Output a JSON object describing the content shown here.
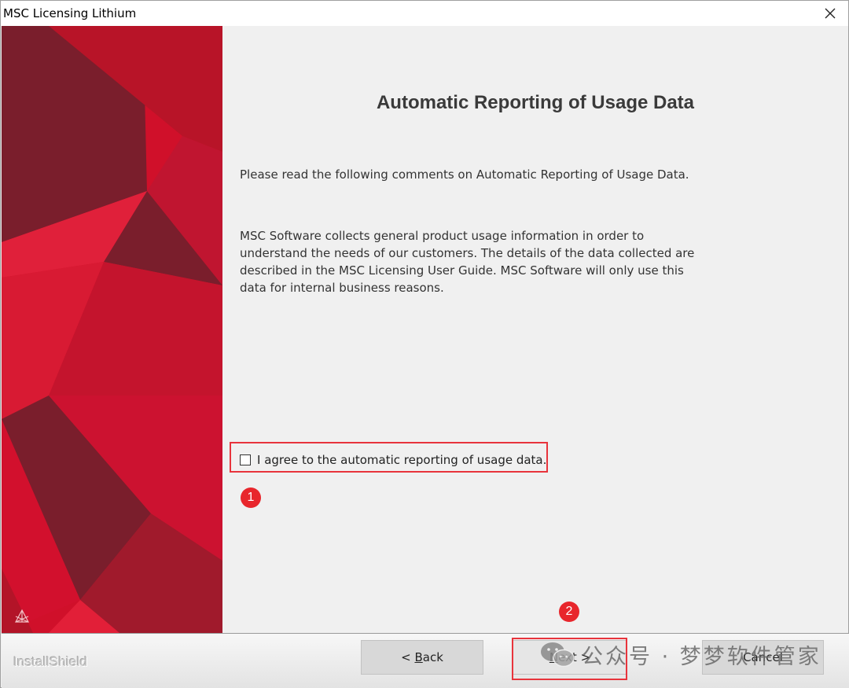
{
  "window": {
    "title": "MSC Licensing Lithium"
  },
  "content": {
    "heading": "Automatic Reporting of Usage Data",
    "intro": "Please read the following comments on Automatic Reporting of Usage Data.",
    "body_lines": [
      "MSC Software collects general product usage information in order to",
      "understand the needs of our customers. The details of the data collected are",
      "described in the MSC Licensing User Guide. MSC Software will only use this",
      "data for internal business reasons."
    ],
    "agree_label": "I agree to the automatic reporting of usage data.",
    "agree_checked": false
  },
  "annotations": {
    "marker_1": "1",
    "marker_2": "2",
    "color": "#e8262c"
  },
  "footer": {
    "brand": "InstallShield",
    "back_prefix": "< ",
    "back_mnemonic": "B",
    "back_rest": "ack",
    "next_mnemonic": "N",
    "next_rest": "ext >",
    "cancel_label": "Cancel"
  },
  "watermark": {
    "text": "公众号 · 梦梦软件管家",
    "icon": "wechat-icon"
  },
  "colors": {
    "sidebar_red": "#d0102a",
    "sidebar_dark": "#7a1e2c",
    "accent": "#e8343c"
  }
}
